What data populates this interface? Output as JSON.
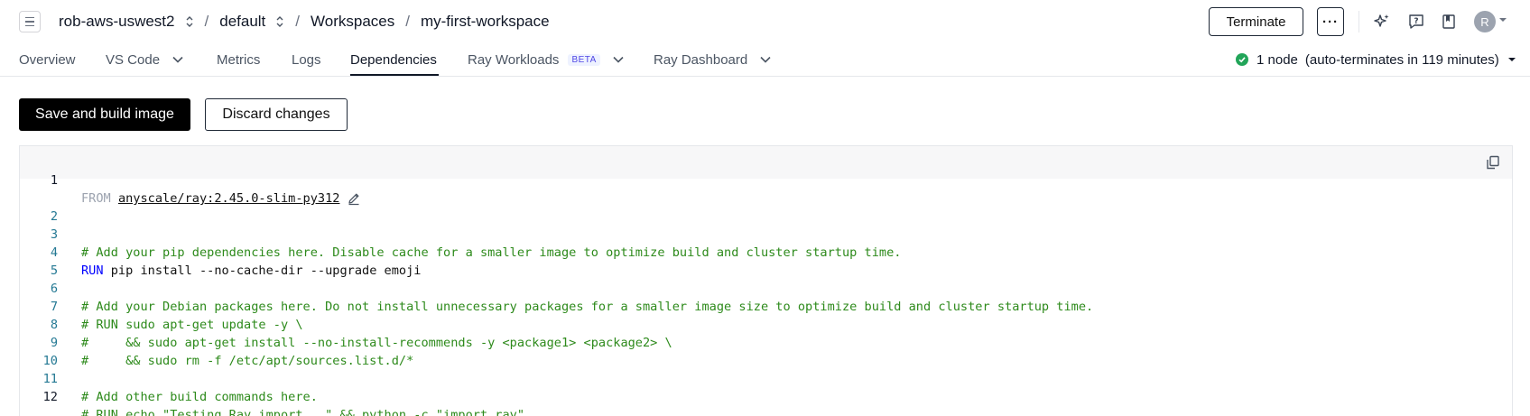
{
  "breadcrumb": {
    "cloud": "rob-aws-uswest2",
    "project": "default",
    "section": "Workspaces",
    "workspace": "my-first-workspace",
    "separator": "/"
  },
  "header": {
    "terminate_label": "Terminate",
    "more_label": "···",
    "avatar_initial": "R"
  },
  "tabs": [
    {
      "label": "Overview"
    },
    {
      "label": "VS Code"
    },
    {
      "label": "Metrics"
    },
    {
      "label": "Logs"
    },
    {
      "label": "Dependencies"
    },
    {
      "label": "Ray Workloads",
      "badge": "BETA"
    },
    {
      "label": "Ray Dashboard"
    }
  ],
  "active_tab": "Dependencies",
  "status": {
    "nodes": "1 node",
    "auto_terminate": "(auto-terminates in 119 minutes)",
    "color": "#22a559"
  },
  "actions": {
    "save_label": "Save and build image",
    "discard_label": "Discard changes"
  },
  "editor": {
    "from_keyword": "FROM",
    "base_image": "anyscale/ray:2.45.0-slim-py312",
    "lines": [
      {
        "n": "1",
        "text": ""
      },
      {
        "n": "2",
        "text": ""
      },
      {
        "n": "3",
        "text": "# Add your pip dependencies here. Disable cache for a smaller image to optimize build and cluster startup time."
      },
      {
        "n": "4",
        "kw": "RUN",
        "text": " pip install --no-cache-dir --upgrade emoji"
      },
      {
        "n": "5",
        "text": ""
      },
      {
        "n": "6",
        "text": "# Add your Debian packages here. Do not install unnecessary packages for a smaller image size to optimize build and cluster startup time."
      },
      {
        "n": "7",
        "text": "# RUN sudo apt-get update -y \\"
      },
      {
        "n": "8",
        "text": "#     && sudo apt-get install --no-install-recommends -y <package1> <package2> \\"
      },
      {
        "n": "9",
        "text": "#     && sudo rm -f /etc/apt/sources.list.d/*"
      },
      {
        "n": "10",
        "text": ""
      },
      {
        "n": "11",
        "text": "# Add other build commands here."
      },
      {
        "n": "12",
        "text": "# RUN echo \"Testing Ray import...\" && python -c \"import ray\""
      }
    ]
  },
  "colors": {
    "accent_black": "#000000",
    "comment_green": "#2d8a1b",
    "keyword_blue": "#0000ff",
    "line_number": "#237893"
  }
}
